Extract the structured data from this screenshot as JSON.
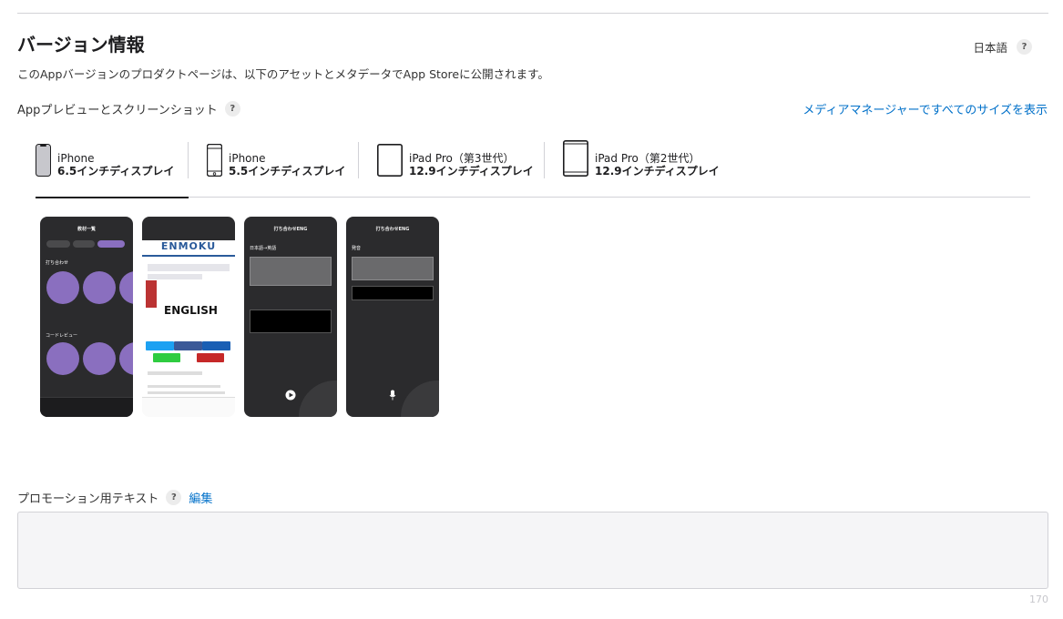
{
  "section": {
    "title": "バージョン情報",
    "language": "日本語",
    "help": "?",
    "description": "このAppバージョンのプロダクトページは、以下のアセットとメタデータでApp Storeに公開されます。"
  },
  "preview": {
    "label": "Appプレビューとスクリーンショット",
    "media_link": "メディアマネージャーですべてのサイズを表示"
  },
  "tabs": [
    {
      "line1": "iPhone",
      "line2": "6.5インチディスプレイ",
      "icon": "iphone-notch-icon",
      "active": true
    },
    {
      "line1": "iPhone",
      "line2": "5.5インチディスプレイ",
      "icon": "iphone-home-button-icon",
      "active": false
    },
    {
      "line1": "iPad Pro（第3世代）",
      "line2": "12.9インチディスプレイ",
      "icon": "ipad-pro-3-icon",
      "active": false
    },
    {
      "line1": "iPad Pro（第2世代）",
      "line2": "12.9インチディスプレイ",
      "icon": "ipad-pro-2-icon",
      "active": false
    }
  ],
  "screenshots": [
    {
      "header": "教材一覧",
      "section1": "打ち合わせ",
      "section2": "コードレビュー"
    },
    {
      "brand": "ENMOKU",
      "word": "ENGLISH"
    },
    {
      "header": "打ち合わせENG",
      "label": "日本語→英語"
    },
    {
      "header": "打ち合わせENG",
      "label": "発音"
    }
  ],
  "promo": {
    "label": "プロモーション用テキスト",
    "edit": "編集",
    "counter": "170"
  },
  "colors": {
    "link": "#0070c9",
    "accent_purple": "#8a6fbf",
    "border": "#d2d2d7"
  }
}
